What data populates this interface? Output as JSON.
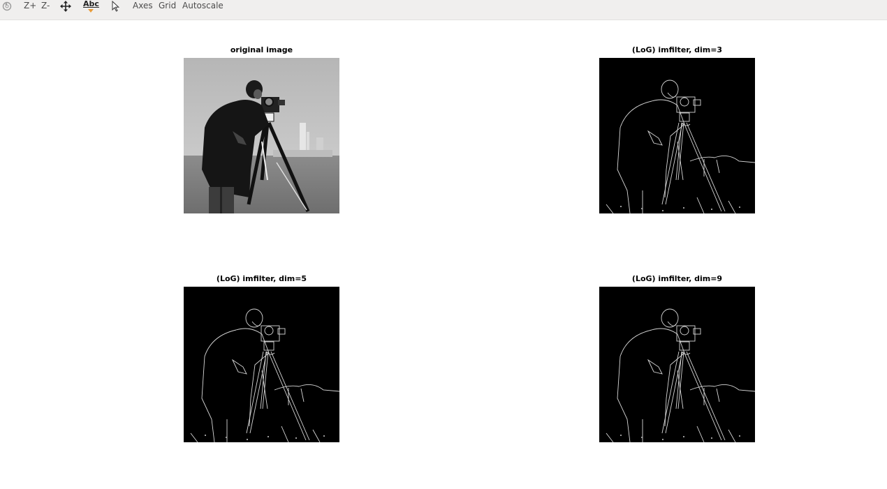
{
  "toolbar": {
    "buttons": [
      {
        "name": "rotate",
        "label": "",
        "icon": "rotate-icon"
      },
      {
        "name": "zoom-in",
        "label": "Z+"
      },
      {
        "name": "zoom-out",
        "label": "Z-"
      },
      {
        "name": "pan",
        "label": "",
        "icon": "pan-cross-arrows-icon"
      },
      {
        "name": "text",
        "label": "",
        "icon": "text-abc-icon"
      },
      {
        "name": "select",
        "label": "",
        "icon": "pointer-icon"
      },
      {
        "name": "axes",
        "label": "Axes"
      },
      {
        "name": "grid",
        "label": "Grid"
      },
      {
        "name": "autoscale",
        "label": "Autoscale"
      }
    ],
    "text_icon_label": "Abc"
  },
  "panels": [
    {
      "title": "original image",
      "variant": "original"
    },
    {
      "title": "(LoG) imfilter, dim=3",
      "variant": "edges"
    },
    {
      "title": "(LoG) imfilter, dim=5",
      "variant": "edges"
    },
    {
      "title": "(LoG) imfilter, dim=9",
      "variant": "edges"
    }
  ],
  "colors": {
    "toolbar_bg": "#f0efee",
    "toolbar_text": "#4c4c4c",
    "text_icon_accent": "#e89c3a",
    "edge_bg": "#000000",
    "edge_line": "#d8d8d8"
  }
}
